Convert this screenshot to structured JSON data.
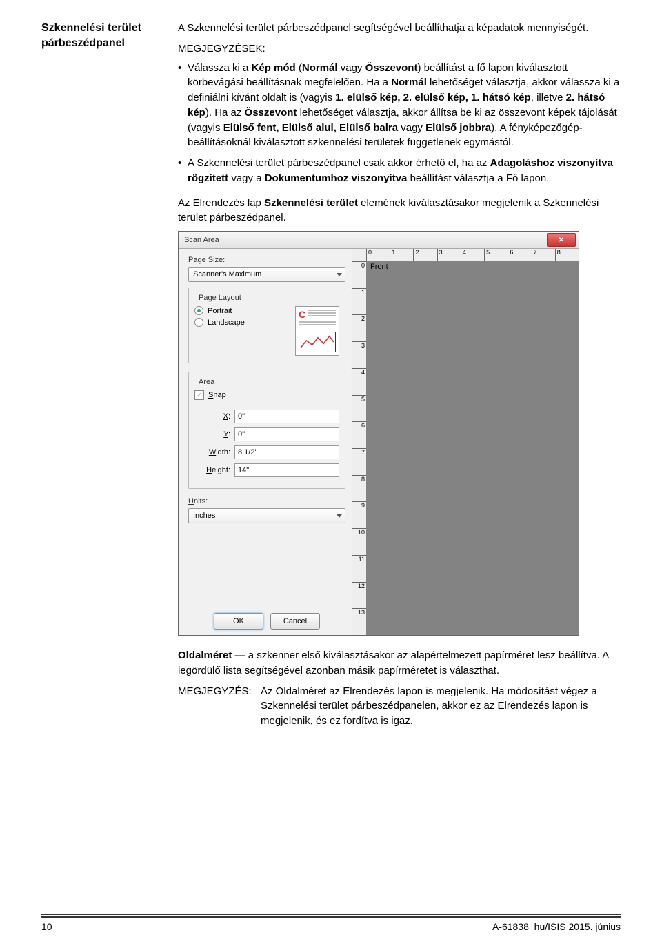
{
  "doc": {
    "section_title_l1": "Szkennelési terület",
    "section_title_l2": "párbeszédpanel",
    "intro_1": "A Szkennelési terület párbeszédpanel segítségével beállíthatja a képadatok mennyiségét.",
    "notes_label": "MEGJEGYZÉSEK:",
    "bullet1_pre": "Válassza ki a ",
    "bullet1_b1": "Kép mód",
    "bullet1_mid1": " (",
    "bullet1_b2": "Normál",
    "bullet1_mid2": " vagy ",
    "bullet1_b3": "Összevont",
    "bullet1_mid3": ") beállítást a fő lapon kiválasztott körbevágási beállításnak megfelelően. Ha a ",
    "bullet1_b4": "Normál",
    "bullet1_mid4": " lehetőséget választja, akkor válassza ki a definiálni kívánt oldalt is (vagyis ",
    "bullet1_b5": "1. elülső kép, 2. elülső kép, 1. hátsó kép",
    "bullet1_mid5": ", illetve ",
    "bullet1_b6": "2. hátsó kép",
    "bullet1_mid6": "). Ha az ",
    "bullet1_b7": "Összevont",
    "bullet1_mid7": " lehetőséget választja, akkor állítsa be ki az összevont képek tájolását (vagyis ",
    "bullet1_b8": "Elülső fent, Elülső alul, Elülső balra",
    "bullet1_mid8": " vagy ",
    "bullet1_b9": "Elülső jobbra",
    "bullet1_mid9": "). A fényképezőgép-beállításoknál kiválasztott szkennelési területek függetlenek egymástól.",
    "bullet2_pre": "A Szkennelési terület párbeszédpanel csak akkor érhető el, ha az ",
    "bullet2_b1": "Adagoláshoz viszonyítva rögzített",
    "bullet2_mid1": " vagy a ",
    "bullet2_b2": "Dokumentumhoz viszonyítva",
    "bullet2_mid2": " beállítást választja a Fő lapon.",
    "select_intro_pre": "Az Elrendezés lap ",
    "select_intro_b": "Szkennelési terület",
    "select_intro_post": " elemének kiválasztásakor megjelenik a Szkennelési terület párbeszédpanel.",
    "oldal_b": "Oldalméret",
    "oldal_after": " — a szkenner első kiválasztásakor az alapértelmezett papírméret lesz beállítva. A legördülő lista segítségével azonban másik papírméretet is választhat.",
    "note2_tag": "MEGJEGYZÉS:",
    "note2_text": "Az Oldalméret az Elrendezés lapon is megjelenik. Ha módosítást végez a Szkennelési terület párbeszédpanelen, akkor ez az Elrendezés lapon is megjelenik, és ez fordítva is igaz."
  },
  "dialog": {
    "title": "Scan Area",
    "page_size_label": "Page Size:",
    "page_size_value": "Scanner's Maximum",
    "page_layout_label": "Page Layout",
    "portrait": "Portrait",
    "landscape": "Landscape",
    "area_label": "Area",
    "snap": "Snap",
    "x_label": "X:",
    "y_label": "Y:",
    "width_label": "Width:",
    "height_label": "Height:",
    "x_val": "0\"",
    "y_val": "0\"",
    "width_val": "8 1/2\"",
    "height_val": "14\"",
    "units_label": "Units:",
    "units_value": "Inches",
    "ok": "OK",
    "cancel": "Cancel",
    "front": "Front",
    "ruler_h": [
      "0",
      "1",
      "2",
      "3",
      "4",
      "5",
      "6",
      "7",
      "8"
    ],
    "ruler_v": [
      "0",
      "1",
      "2",
      "3",
      "4",
      "5",
      "6",
      "7",
      "8",
      "9",
      "10",
      "11",
      "12",
      "13"
    ]
  },
  "footer": {
    "page": "10",
    "right": "A-61838_hu/ISIS  2015. június"
  }
}
